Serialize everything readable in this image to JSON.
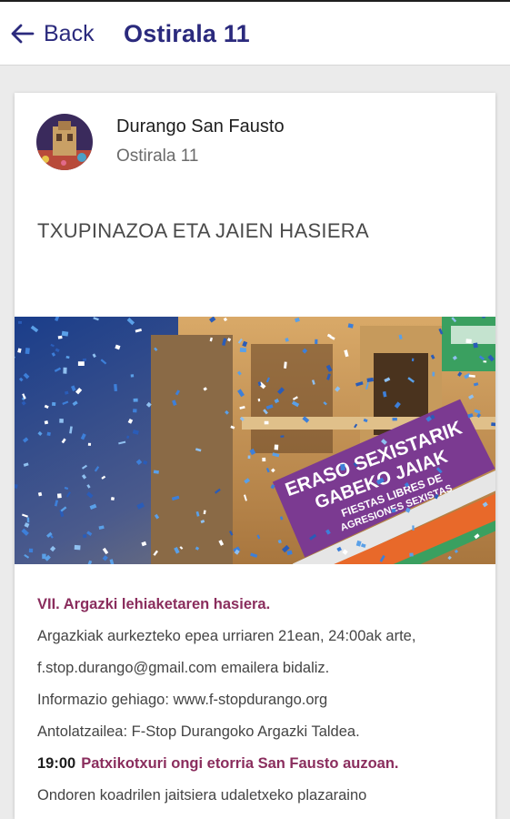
{
  "header": {
    "back_label": "Back",
    "title": "Ostirala 11"
  },
  "post": {
    "author": "Durango San Fausto",
    "date": "Ostirala 11",
    "heading": "TXUPINAZOA ETA JAIEN HASIERA",
    "banner_text": {
      "line1": "ERASO SEXISTARIK",
      "line2": "GABEKO JAIAK",
      "line3": "FIESTAS LIBRES DE",
      "line4": "AGRESIONES SEXISTAS"
    },
    "body": {
      "subtitle": "VII. Argazki lehiaketaren hasiera.",
      "line1": "Argazkiak aurkezteko epea urriaren 21ean, 24:00ak arte,",
      "line2": "f.stop.durango@gmail.com emailera bidaliz.",
      "line3": "Informazio gehiago: www.f-stopdurango.org",
      "line4": "Antolatzailea: F-Stop Durangoko Argazki Taldea.",
      "time": "19:00",
      "event": "Patxikotxuri ongi etorria San Fausto auzoan.",
      "line5": "Ondoren koadrilen jaitsiera udaletxeko plazaraino"
    }
  },
  "colors": {
    "accent_navy": "#2b2a7d",
    "accent_plum": "#8a2d5d",
    "banner_purple": "#7b3a91"
  },
  "icons": {
    "back": "arrow-left-icon"
  }
}
